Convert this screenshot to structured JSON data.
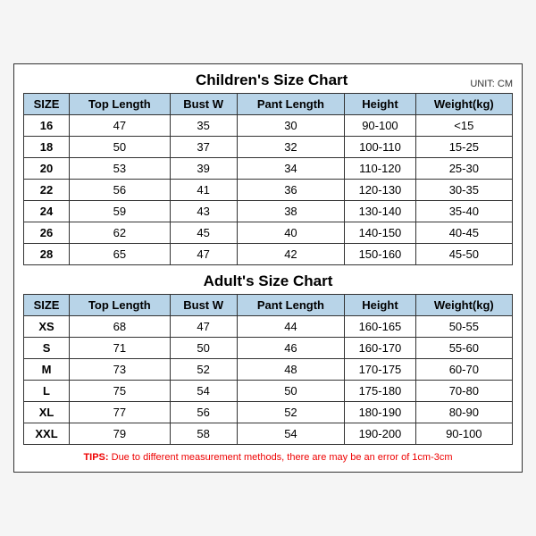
{
  "children": {
    "title": "Children's Size Chart",
    "unit": "UNIT: CM",
    "headers": [
      "SIZE",
      "Top Length",
      "Bust W",
      "Pant Length",
      "Height",
      "Weight(kg)"
    ],
    "rows": [
      [
        "16",
        "47",
        "35",
        "30",
        "90-100",
        "<15"
      ],
      [
        "18",
        "50",
        "37",
        "32",
        "100-110",
        "15-25"
      ],
      [
        "20",
        "53",
        "39",
        "34",
        "110-120",
        "25-30"
      ],
      [
        "22",
        "56",
        "41",
        "36",
        "120-130",
        "30-35"
      ],
      [
        "24",
        "59",
        "43",
        "38",
        "130-140",
        "35-40"
      ],
      [
        "26",
        "62",
        "45",
        "40",
        "140-150",
        "40-45"
      ],
      [
        "28",
        "65",
        "47",
        "42",
        "150-160",
        "45-50"
      ]
    ]
  },
  "adult": {
    "title": "Adult's Size Chart",
    "headers": [
      "SIZE",
      "Top Length",
      "Bust W",
      "Pant Length",
      "Height",
      "Weight(kg)"
    ],
    "rows": [
      [
        "XS",
        "68",
        "47",
        "44",
        "160-165",
        "50-55"
      ],
      [
        "S",
        "71",
        "50",
        "46",
        "160-170",
        "55-60"
      ],
      [
        "M",
        "73",
        "52",
        "48",
        "170-175",
        "60-70"
      ],
      [
        "L",
        "75",
        "54",
        "50",
        "175-180",
        "70-80"
      ],
      [
        "XL",
        "77",
        "56",
        "52",
        "180-190",
        "80-90"
      ],
      [
        "XXL",
        "79",
        "58",
        "54",
        "190-200",
        "90-100"
      ]
    ]
  },
  "tips": {
    "label": "TIPS:",
    "text": " Due to different measurement methods, there are may be an error of 1cm-3cm"
  }
}
